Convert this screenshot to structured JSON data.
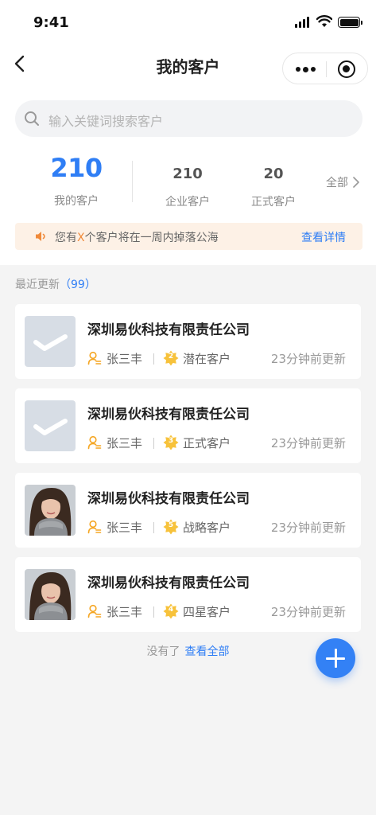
{
  "status_bar": {
    "time": "9:41"
  },
  "nav": {
    "title": "我的客户"
  },
  "search": {
    "placeholder": "输入关键词搜索客户"
  },
  "stats": {
    "my_count": "210",
    "my_label": "我的客户",
    "enterprise_count": "210",
    "enterprise_label": "企业客户",
    "formal_count": "20",
    "formal_label": "正式客户",
    "all_label": "全部"
  },
  "notice": {
    "prefix": "您有",
    "highlight": "X",
    "suffix": "个客户将在一周内掉落公海",
    "link": "查看详情"
  },
  "section": {
    "title": "最近更新",
    "count": "（99）"
  },
  "customers": [
    {
      "company": "深圳易伙科技有限责任公司",
      "owner": "张三丰",
      "badge": "2",
      "level": "潜在客户",
      "updated": "23分钟前更新",
      "avatar": "placeholder-logo"
    },
    {
      "company": "深圳易伙科技有限责任公司",
      "owner": "张三丰",
      "badge": "3",
      "level": "正式客户",
      "updated": "23分钟前更新",
      "avatar": "placeholder-logo"
    },
    {
      "company": "深圳易伙科技有限责任公司",
      "owner": "张三丰",
      "badge": "5",
      "level": "战略客户",
      "updated": "23分钟前更新",
      "avatar": "person-photo"
    },
    {
      "company": "深圳易伙科技有限责任公司",
      "owner": "张三丰",
      "badge": "4",
      "level": "四星客户",
      "updated": "23分钟前更新",
      "avatar": "person-photo"
    }
  ],
  "footer": {
    "text": "没有了",
    "link": "查看全部"
  },
  "colors": {
    "accent": "#2f7ef5",
    "fab": "#3381f5",
    "badge": "#f7c23b",
    "notice_bg": "#fdf1e6",
    "highlight": "#f08a3a"
  }
}
